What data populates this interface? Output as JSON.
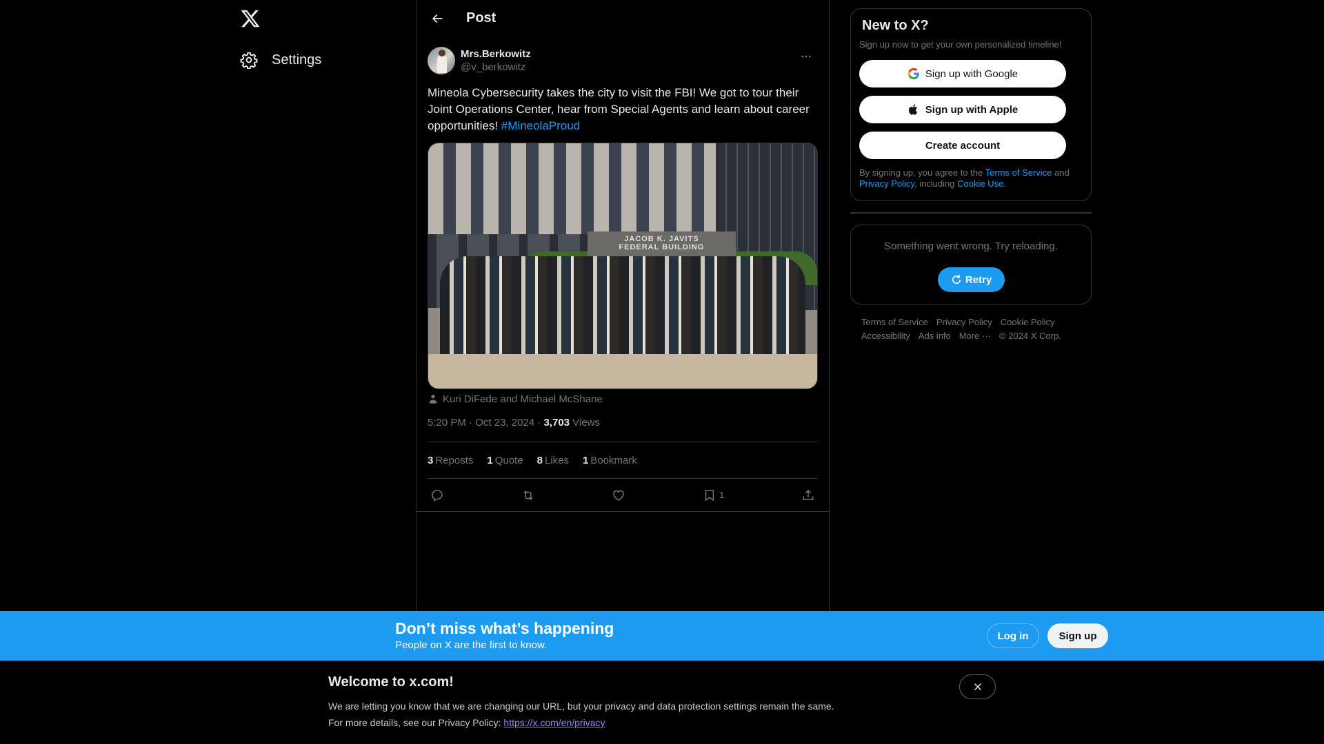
{
  "nav": {
    "logo": "x-logo",
    "settings_label": "Settings"
  },
  "header": {
    "title": "Post"
  },
  "post": {
    "author_name": "Mrs.Berkowitz",
    "author_handle": "@v_berkowitz",
    "text": "Mineola Cybersecurity takes the city to visit the FBI! We got to tour their Joint Operations Center, hear from Special Agents and learn about career opportunities! ",
    "hashtag": "#MineolaProud",
    "media_alt": "Group photo in front of the Jacob K. Javits Federal Building",
    "media_sign_line1": "JACOB K. JAVITS",
    "media_sign_line2": "FEDERAL BUILDING",
    "tagged_people": "Kuri DiFede and Michael McShane",
    "time": "5:20 PM",
    "date": "Oct 23, 2024",
    "views_count": "3,703",
    "views_label": "Views",
    "stats": [
      {
        "count": "3",
        "label": "Reposts"
      },
      {
        "count": "1",
        "label": "Quote"
      },
      {
        "count": "8",
        "label": "Likes"
      },
      {
        "count": "1",
        "label": "Bookmark"
      }
    ],
    "actions": {
      "bookmark_count": "1"
    }
  },
  "sidebar": {
    "signup_card": {
      "title": "New to X?",
      "subtitle": "Sign up now to get your own personalized timeline!",
      "google_label": "Sign up with Google",
      "apple_label": "Sign up with Apple",
      "create_label": "Create account",
      "legal_prefix": "By signing up, you agree to the ",
      "terms_link": "Terms of Service",
      "legal_and": " and ",
      "privacy_link": "Privacy Policy",
      "legal_including": ", including ",
      "cookie_link": "Cookie Use."
    },
    "error_card": {
      "message": "Something went wrong. Try reloading.",
      "retry_label": "Retry"
    },
    "footer_links": [
      "Terms of Service",
      "Privacy Policy",
      "Cookie Policy",
      "Accessibility",
      "Ads info",
      "More ···"
    ],
    "copyright": "© 2024 X Corp."
  },
  "banner": {
    "title": "Don’t miss what’s happening",
    "subtitle": "People on X are the first to know.",
    "login_label": "Log in",
    "signup_label": "Sign up",
    "color": "#1d9bf0"
  },
  "welcome": {
    "title": "Welcome to x.com!",
    "line1": "We are letting you know that we are changing our URL, but your privacy and data protection settings remain the same.",
    "line2_prefix": "For more details, see our Privacy Policy: ",
    "line2_link": "https://x.com/en/privacy"
  }
}
